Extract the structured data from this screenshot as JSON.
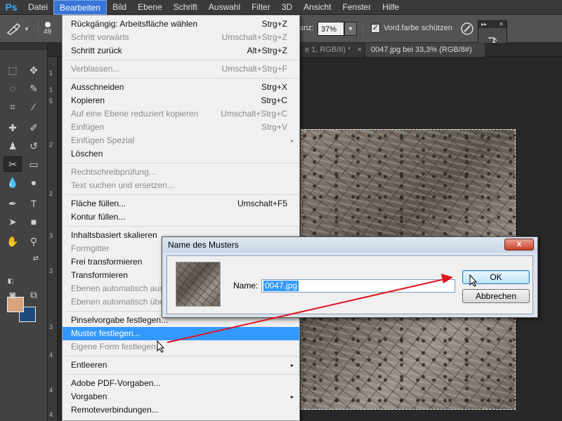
{
  "menubar": {
    "logo": "Ps",
    "items": [
      "Datei",
      "Bearbeiten",
      "Bild",
      "Ebene",
      "Schrift",
      "Auswahl",
      "Filter",
      "3D",
      "Ansicht",
      "Fenster",
      "Hilfe"
    ],
    "active": "Bearbeiten"
  },
  "optionsbar": {
    "brush_size": "49",
    "opacity_label": "anz:",
    "opacity_value": "37%",
    "checkbox_label": "Vord.farbe schützen",
    "checkbox_checked": "✓"
  },
  "mini_panel": {
    "collapse": "▸▸",
    "close": "✕"
  },
  "tabs": {
    "inactive": "e 1, RGB/8) *",
    "inactive_close": "×",
    "active": "0047.jpg bei 33,3% (RGB/8#)",
    "active_close": "×"
  },
  "ruler": {
    "numbers": [
      "1",
      "1",
      "5",
      "2",
      "2",
      "3",
      "3",
      "3",
      "4",
      "4",
      "4"
    ]
  },
  "menu": {
    "items": [
      {
        "label": "Rückgängig: Arbeitsfläche wählen",
        "shortcut": "Strg+Z"
      },
      {
        "label": "Schritt vorwärts",
        "shortcut": "Umschalt+Strg+Z"
      },
      {
        "label": "Schritt zurück",
        "shortcut": "Alt+Strg+Z"
      },
      {
        "label": "Verblassen...",
        "shortcut": "Umschalt+Strg+F"
      },
      {
        "label": "Ausschneiden",
        "shortcut": "Strg+X"
      },
      {
        "label": "Kopieren",
        "shortcut": "Strg+C"
      },
      {
        "label": "Auf eine Ebene reduziert kopieren",
        "shortcut": "Umschalt+Strg+C"
      },
      {
        "label": "Einfügen",
        "shortcut": "Strg+V"
      },
      {
        "label": "Einfügen Spezial",
        "shortcut": ""
      },
      {
        "label": "Löschen",
        "shortcut": ""
      },
      {
        "label": "Rechtschreibprüfung...",
        "shortcut": ""
      },
      {
        "label": "Text suchen und ersetzen...",
        "shortcut": ""
      },
      {
        "label": "Fläche füllen...",
        "shortcut": "Umschalt+F5"
      },
      {
        "label": "Kontur füllen...",
        "shortcut": ""
      },
      {
        "label": "Inhaltsbasiert skalieren",
        "shortcut": ""
      },
      {
        "label": "Formgitter",
        "shortcut": ""
      },
      {
        "label": "Frei transformieren",
        "shortcut": ""
      },
      {
        "label": "Transformieren",
        "shortcut": ""
      },
      {
        "label": "Ebenen automatisch aus",
        "shortcut": ""
      },
      {
        "label": "Ebenen automatisch übe",
        "shortcut": ""
      },
      {
        "label": "Pinselvorgabe festlegen...",
        "shortcut": ""
      },
      {
        "label": "Muster festlegen...",
        "shortcut": ""
      },
      {
        "label": "Eigene Form festlegen...",
        "shortcut": ""
      },
      {
        "label": "Entleeren",
        "shortcut": ""
      },
      {
        "label": "Adobe PDF-Vorgaben...",
        "shortcut": ""
      },
      {
        "label": "Vorgaben",
        "shortcut": ""
      },
      {
        "label": "Remoteverbindungen...",
        "shortcut": ""
      }
    ],
    "submenu_arrow": "▸"
  },
  "dialog": {
    "title": "Name des Musters",
    "close": "x",
    "name_label": "Name:",
    "name_value": "0047.jpg",
    "ok_label": "OK",
    "cancel_label": "Abbrechen"
  },
  "colors": {
    "foreground": "#d8a37f",
    "background": "#1f4a7e",
    "annotation_arrow": "#e0141e"
  }
}
